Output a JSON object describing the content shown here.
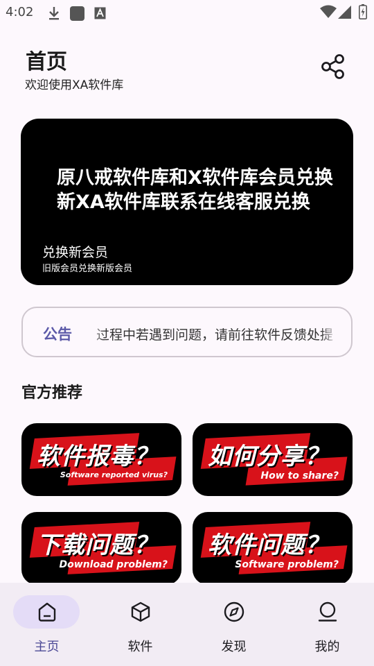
{
  "status_bar": {
    "time": "4:02",
    "icons": [
      "download-icon",
      "app-square-icon",
      "a-box-icon",
      "wifi-icon",
      "signal-icon",
      "battery-charging-icon"
    ]
  },
  "header": {
    "title": "首页",
    "subtitle": "欢迎使用XA软件库",
    "share_icon": "share-icon"
  },
  "banner": {
    "main_text": "原八戒软件库和X软件库会员兑换新XA软件库联系在线客服兑换",
    "title": "兑换新会员",
    "subtitle": "旧版会员兑换新版会员"
  },
  "notice": {
    "label": "公告",
    "text": "过程中若遇到问题，请前往软件反馈处提"
  },
  "section": {
    "title": "官方推荐"
  },
  "recommendations": [
    {
      "title": "软件报毒？",
      "subtitle": "Software reported virus?"
    },
    {
      "title": "如何分享？",
      "subtitle": "How to share?"
    },
    {
      "title": "下载问题？",
      "subtitle": "Download problem?"
    },
    {
      "title": "软件问题？",
      "subtitle": "Software problem?"
    }
  ],
  "bottom_nav": {
    "items": [
      {
        "label": "主页",
        "icon": "home-icon",
        "active": true
      },
      {
        "label": "软件",
        "icon": "package-icon",
        "active": false
      },
      {
        "label": "发现",
        "icon": "compass-icon",
        "active": false
      },
      {
        "label": "我的",
        "icon": "person-icon",
        "active": false
      }
    ]
  },
  "colors": {
    "background": "#fdf8fd",
    "accent": "#5b59a8",
    "nav_background": "#f2ecf4",
    "nav_active_pill": "#e4dcf7",
    "card_red": "#d8121a"
  }
}
